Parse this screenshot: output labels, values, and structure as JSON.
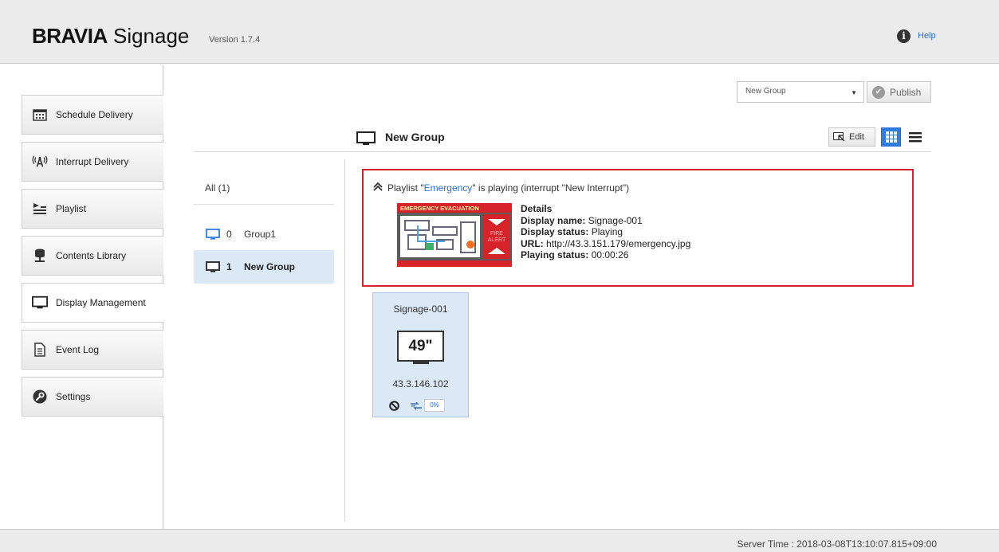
{
  "header": {
    "brand_bold": "BRAVIA",
    "brand_rest": " Signage",
    "version": "Version 1.7.4",
    "help_label": "Help"
  },
  "sidebar": {
    "items": [
      {
        "label": "Schedule Delivery",
        "icon": "calendar-icon"
      },
      {
        "label": "Interrupt Delivery",
        "icon": "broadcast-icon"
      },
      {
        "label": "Playlist",
        "icon": "playlist-icon"
      },
      {
        "label": "Contents Library",
        "icon": "database-icon"
      },
      {
        "label": "Display Management",
        "icon": "monitor-icon",
        "active": true
      },
      {
        "label": "Event Log",
        "icon": "document-icon"
      },
      {
        "label": "Settings",
        "icon": "wrench-icon"
      }
    ]
  },
  "toolbar": {
    "group_select_value": "New Group",
    "publish_label": "Publish",
    "edit_label": "Edit"
  },
  "main": {
    "group_title": "New Group"
  },
  "groups": {
    "all_label": "All (1)",
    "items": [
      {
        "count": "0",
        "name": "Group1"
      },
      {
        "count": "1",
        "name": "New Group",
        "selected": true
      }
    ]
  },
  "status": {
    "prefix": "Playlist \"",
    "playlist_name": "Emergency",
    "suffix": "\" is playing (interrupt \"New Interrupt\")",
    "thumbnail": {
      "banner": "EMERGENCY EVACUATION",
      "side_text_1": "FIRE",
      "side_text_2": "ALERT"
    },
    "details_title": "Details",
    "display_name_label": "Display name:",
    "display_name": "Signage-001",
    "display_status_label": "Display status:",
    "display_status": "Playing",
    "url_label": "URL:",
    "url": "http://43.3.151.179/emergency.jpg",
    "playing_status_label": "Playing status:",
    "playing_status": "00:00:26"
  },
  "display_card": {
    "name": "Signage-001",
    "size": "49\"",
    "ip": "43.3.146.102",
    "progress": "0%"
  },
  "footer": {
    "server_time": "Server Time : 2018-03-08T13:10:07.815+09:00"
  },
  "colors": {
    "accent": "#2f7de1",
    "alert_border": "#d6232a",
    "selected_bg": "#dbe8f6"
  }
}
